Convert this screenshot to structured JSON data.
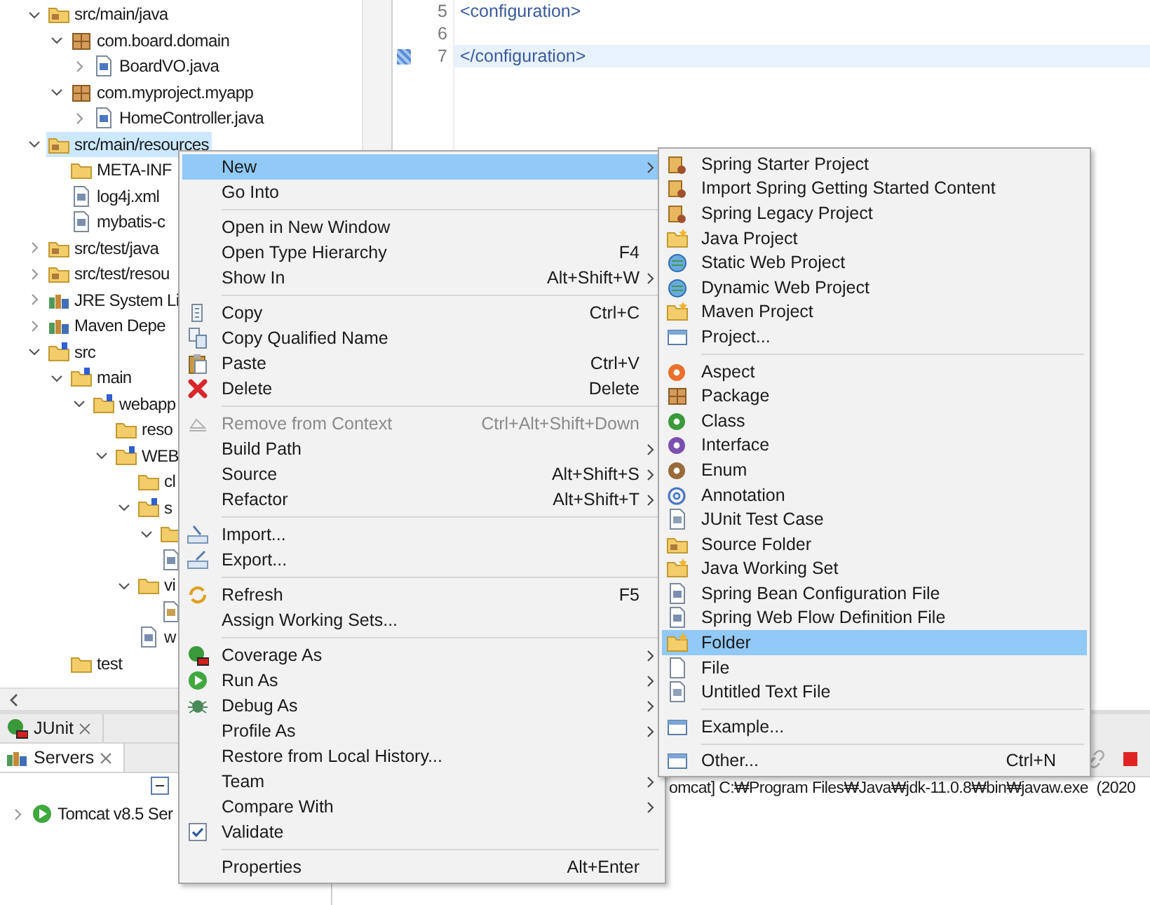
{
  "project_tree": [
    {
      "label": "src/main/java",
      "kind": "source-folder",
      "expanded": true,
      "selected": false,
      "children": [
        {
          "label": "com.board.domain",
          "kind": "package",
          "expanded": true,
          "selected": false,
          "children": [
            {
              "label": "BoardVO.java",
              "kind": "java-file",
              "expanded": false,
              "selected": false
            }
          ]
        },
        {
          "label": "com.myproject.myapp",
          "kind": "package",
          "expanded": true,
          "selected": false,
          "children": [
            {
              "label": "HomeController.java",
              "kind": "java-file",
              "expanded": false,
              "selected": false
            }
          ]
        }
      ]
    },
    {
      "label": "src/main/resources",
      "kind": "source-folder",
      "expanded": true,
      "selected": true,
      "children": [
        {
          "label": "META-INF",
          "kind": "folder",
          "selected": false
        },
        {
          "label": "log4j.xml",
          "kind": "xml-file",
          "selected": false
        },
        {
          "label": "mybatis-c",
          "kind": "xml-file",
          "selected": false
        }
      ]
    },
    {
      "label": "src/test/java",
      "kind": "source-folder",
      "expanded": false,
      "selected": false
    },
    {
      "label": "src/test/resou",
      "kind": "source-folder",
      "expanded": false,
      "selected": false
    },
    {
      "label": "JRE System Li",
      "kind": "library",
      "expanded": false,
      "selected": false
    },
    {
      "label": "Maven Depe",
      "kind": "library",
      "expanded": false,
      "selected": false
    },
    {
      "label": "src",
      "kind": "spring-folder",
      "expanded": true,
      "selected": false,
      "children": [
        {
          "label": "main",
          "kind": "spring-folder",
          "expanded": true,
          "selected": false,
          "children": [
            {
              "label": "webapp",
              "kind": "spring-folder",
              "expanded": true,
              "selected": false,
              "children": [
                {
                  "label": "reso",
                  "kind": "folder",
                  "selected": false
                },
                {
                  "label": "WEB",
                  "kind": "spring-folder",
                  "expanded": true,
                  "selected": false,
                  "children": [
                    {
                      "label": "cl",
                      "kind": "folder",
                      "selected": false
                    },
                    {
                      "label": "s",
                      "kind": "spring-folder",
                      "expanded": true,
                      "selected": false,
                      "children": [
                        {
                          "kind": "folder",
                          "expanded": true,
                          "selected": false
                        },
                        {
                          "kind": "xml-file",
                          "selected": false
                        }
                      ]
                    },
                    {
                      "label": "vi",
                      "kind": "folder",
                      "expanded": true,
                      "selected": false,
                      "children": [
                        {
                          "kind": "jsp-file",
                          "selected": false
                        }
                      ]
                    },
                    {
                      "label": "w",
                      "kind": "xml-file",
                      "selected": false
                    }
                  ]
                }
              ]
            }
          ]
        },
        {
          "label": "test",
          "kind": "folder",
          "selected": false
        }
      ]
    }
  ],
  "editor": {
    "lines": [
      {
        "number": "5",
        "code": "<configuration>",
        "current": false
      },
      {
        "number": "6",
        "current": false
      },
      {
        "number": "7",
        "code": "</configuration>",
        "current": true
      }
    ]
  },
  "bottom_tabs": [
    {
      "label": "JUnit",
      "selected": false
    },
    {
      "label": "Servers",
      "selected": true
    }
  ],
  "servers": [
    {
      "label": "Tomcat v8.5 Ser",
      "expanded": false
    }
  ],
  "console_line": "omcat] C:₩Program Files₩Java₩jdk-11.0.8₩bin₩javaw.exe  (2020",
  "context_menu": {
    "groups": [
      [
        {
          "label": "New",
          "submenu": true,
          "selected": true,
          "disabled": false
        },
        {
          "label": "Go Into",
          "submenu": false,
          "selected": false,
          "disabled": false
        }
      ],
      [
        {
          "label": "Open in New Window",
          "submenu": false,
          "selected": false,
          "disabled": false
        },
        {
          "label": "Open Type Hierarchy",
          "shortcut": "F4",
          "submenu": false,
          "selected": false,
          "disabled": false
        },
        {
          "label": "Show In",
          "shortcut": "Alt+Shift+W",
          "submenu": true,
          "selected": false,
          "disabled": false
        }
      ],
      [
        {
          "label": "Copy",
          "shortcut": "Ctrl+C",
          "submenu": false,
          "selected": false,
          "disabled": false
        },
        {
          "label": "Copy Qualified Name",
          "submenu": false,
          "selected": false,
          "disabled": false
        },
        {
          "label": "Paste",
          "shortcut": "Ctrl+V",
          "submenu": false,
          "selected": false,
          "disabled": false
        },
        {
          "label": "Delete",
          "shortcut": "Delete",
          "submenu": false,
          "selected": false,
          "disabled": false
        }
      ],
      [
        {
          "label": "Remove from Context",
          "shortcut": "Ctrl+Alt+Shift+Down",
          "submenu": false,
          "selected": false,
          "disabled": true
        },
        {
          "label": "Build Path",
          "submenu": true,
          "selected": false,
          "disabled": false
        },
        {
          "label": "Source",
          "shortcut": "Alt+Shift+S",
          "submenu": true,
          "selected": false,
          "disabled": false
        },
        {
          "label": "Refactor",
          "shortcut": "Alt+Shift+T",
          "submenu": true,
          "selected": false,
          "disabled": false
        }
      ],
      [
        {
          "label": "Import...",
          "submenu": false,
          "selected": false,
          "disabled": false
        },
        {
          "label": "Export...",
          "submenu": false,
          "selected": false,
          "disabled": false
        }
      ],
      [
        {
          "label": "Refresh",
          "shortcut": "F5",
          "submenu": false,
          "selected": false,
          "disabled": false
        },
        {
          "label": "Assign Working Sets...",
          "submenu": false,
          "selected": false,
          "disabled": false
        }
      ],
      [
        {
          "label": "Coverage As",
          "submenu": true,
          "selected": false,
          "disabled": false
        },
        {
          "label": "Run As",
          "submenu": true,
          "selected": false,
          "disabled": false
        },
        {
          "label": "Debug As",
          "submenu": true,
          "selected": false,
          "disabled": false
        },
        {
          "label": "Profile As",
          "submenu": true,
          "selected": false,
          "disabled": false
        },
        {
          "label": "Restore from Local History...",
          "submenu": false,
          "selected": false,
          "disabled": false
        },
        {
          "label": "Team",
          "submenu": true,
          "selected": false,
          "disabled": false
        },
        {
          "label": "Compare With",
          "submenu": true,
          "selected": false,
          "disabled": false
        },
        {
          "label": "Validate",
          "submenu": false,
          "selected": false,
          "disabled": false
        }
      ],
      [
        {
          "label": "Properties",
          "shortcut": "Alt+Enter",
          "submenu": false,
          "selected": false,
          "disabled": false
        }
      ]
    ]
  },
  "new_submenu": {
    "groups": [
      [
        {
          "label": "Spring Starter Project",
          "selected": false
        },
        {
          "label": "Import Spring Getting Started Content",
          "selected": false
        },
        {
          "label": "Spring Legacy Project",
          "selected": false
        },
        {
          "label": "Java Project",
          "selected": false
        },
        {
          "label": "Static Web Project",
          "selected": false
        },
        {
          "label": "Dynamic Web Project",
          "selected": false
        },
        {
          "label": "Maven Project",
          "selected": false
        },
        {
          "label": "Project...",
          "selected": false
        }
      ],
      [
        {
          "label": "Aspect",
          "selected": false
        },
        {
          "label": "Package",
          "selected": false
        },
        {
          "label": "Class",
          "selected": false
        },
        {
          "label": "Interface",
          "selected": false
        },
        {
          "label": "Enum",
          "selected": false
        },
        {
          "label": "Annotation",
          "selected": false
        },
        {
          "label": "JUnit Test Case",
          "selected": false
        },
        {
          "label": "Source Folder",
          "selected": false
        },
        {
          "label": "Java Working Set",
          "selected": false
        },
        {
          "label": "Spring Bean Configuration File",
          "selected": false
        },
        {
          "label": "Spring Web Flow Definition File",
          "selected": false
        },
        {
          "label": "Folder",
          "selected": true
        },
        {
          "label": "File",
          "selected": false
        },
        {
          "label": "Untitled Text File",
          "selected": false
        }
      ],
      [
        {
          "label": "Example...",
          "selected": false
        }
      ],
      [
        {
          "label": "Other...",
          "shortcut": "Ctrl+N",
          "selected": false
        }
      ]
    ]
  }
}
